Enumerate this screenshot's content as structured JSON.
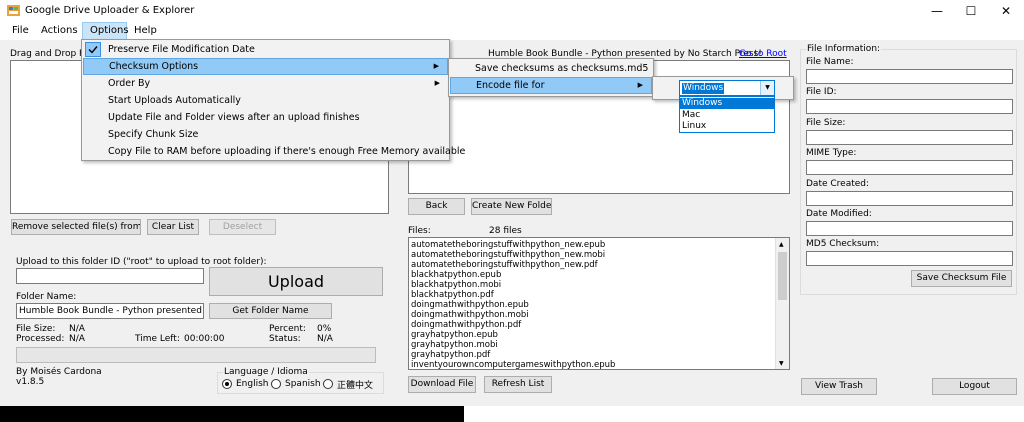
{
  "window": {
    "title": "Google Drive Uploader & Explorer",
    "icon": "app-icon",
    "minimize": "—",
    "maximize": "☐",
    "close": "✕"
  },
  "menubar": {
    "file": "File",
    "actions": "Actions",
    "options": "Options",
    "help": "Help"
  },
  "options_menu": {
    "items": [
      "Preserve File Modification Date",
      "Checksum Options",
      "Order By",
      "Start Uploads Automatically",
      "Update File and Folder views after an upload finishes",
      "Specify Chunk Size",
      "Copy File to RAM before uploading if there's enough Free Memory available"
    ]
  },
  "checksum_menu": {
    "items": [
      "Save checksums as checksums.md5",
      "Encode file for"
    ]
  },
  "encode_dropdown": {
    "selected": "Windows",
    "options": [
      "Windows",
      "Mac",
      "Linux"
    ]
  },
  "left": {
    "drop_label": "Drag and Drop Files",
    "remove_btn": "Remove selected file(s) from list",
    "clear_btn": "Clear List",
    "deselect_btn": "Deselect",
    "upload_folder_label": "Upload to this folder ID (\"root\" to upload to root folder):",
    "upload_btn": "Upload",
    "folder_name_label": "Folder Name:",
    "folder_name_value": "Humble Book Bundle - Python presented by No St",
    "get_folder_btn": "Get Folder Name",
    "file_size_label": "File Size:",
    "file_size_value": "N/A",
    "processed_label": "Processed:",
    "processed_value": "N/A",
    "time_left_label": "Time Left:",
    "time_left_value": "00:00:00",
    "percent_label": "Percent:",
    "percent_value": "0%",
    "status_label": "Status:",
    "status_value": "N/A",
    "author": "By Moisés Cardona",
    "version": "v1.8.5",
    "language_label": "Language / Idioma",
    "lang_en": "English",
    "lang_es": "Spanish",
    "lang_zh": "正體中文"
  },
  "middle": {
    "folder_title": "Humble Book Bundle - Python presented by No Starch Press!",
    "go_root": "Go to Root",
    "back_btn": "Back",
    "new_folder_btn": "Create New Folder",
    "files_label": "Files:",
    "files_count": "28 files",
    "files": [
      "automatetheboringstuffwithpython_new.epub",
      "automatetheboringstuffwithpython_new.mobi",
      "automatetheboringstuffwithpython_new.pdf",
      "blackhatpython.epub",
      "blackhatpython.mobi",
      "blackhatpython.pdf",
      "doingmathwithpython.epub",
      "doingmathwithpython.mobi",
      "doingmathwithpython.pdf",
      "grayhatpython.epub",
      "grayhatpython.mobi",
      "grayhatpython.pdf",
      "inventyourowncomputergameswithpython.epub"
    ],
    "download_btn": "Download File",
    "refresh_btn": "Refresh List"
  },
  "right": {
    "group_title": "File Information:",
    "file_name": "File Name:",
    "file_id": "File ID:",
    "file_size": "File Size:",
    "mime_type": "MIME Type:",
    "date_created": "Date Created:",
    "date_modified": "Date Modified:",
    "md5": "MD5 Checksum:",
    "save_checksum_btn": "Save Checksum File",
    "view_trash_btn": "View Trash",
    "logout_btn": "Logout"
  },
  "colors": {
    "highlight": "#91c9f7",
    "selection": "#0078d7",
    "link": "#0000ff"
  }
}
